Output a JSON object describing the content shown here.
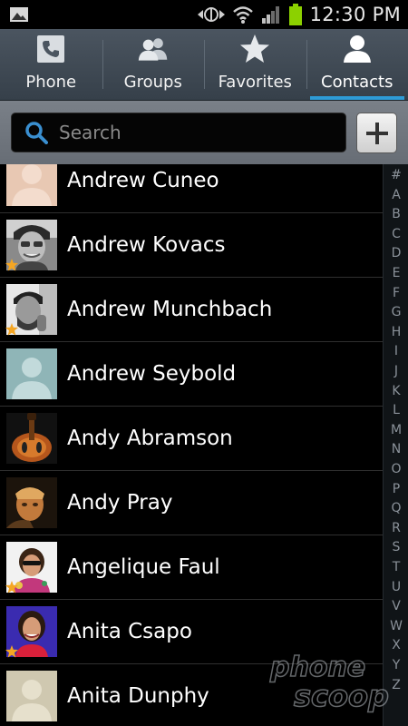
{
  "status_bar": {
    "time": "12:30 PM",
    "icons": [
      "gallery-notification-icon",
      "data-sync-icon",
      "wifi-icon",
      "signal-icon",
      "battery-icon"
    ],
    "battery_color": "#8cd100"
  },
  "tabs": [
    {
      "label": "Phone",
      "icon": "phone-icon",
      "active": false
    },
    {
      "label": "Groups",
      "icon": "groups-icon",
      "active": false
    },
    {
      "label": "Favorites",
      "icon": "star-icon",
      "active": false
    },
    {
      "label": "Contacts",
      "icon": "contact-person-icon",
      "active": true
    }
  ],
  "search": {
    "placeholder": "Search",
    "value": ""
  },
  "add_button": {
    "icon": "plus-icon"
  },
  "contacts": [
    {
      "name": "Andrew Cuneo",
      "favorite": false,
      "avatar": "default-avatar-tan"
    },
    {
      "name": "Andrew Kovacs",
      "favorite": true,
      "avatar": "photo-bw-face"
    },
    {
      "name": "Andrew Munchbach",
      "favorite": true,
      "avatar": "photo-bw-beard"
    },
    {
      "name": "Andrew Seybold",
      "favorite": false,
      "avatar": "default-avatar-teal"
    },
    {
      "name": "Andy Abramson",
      "favorite": false,
      "avatar": "photo-guitar"
    },
    {
      "name": "Andy Pray",
      "favorite": false,
      "avatar": "photo-warm-face"
    },
    {
      "name": "Angelique Faul",
      "favorite": true,
      "avatar": "photo-woman-sunglasses"
    },
    {
      "name": "Anita Csapo",
      "favorite": true,
      "avatar": "photo-woman-red"
    },
    {
      "name": "Anita Dunphy",
      "favorite": false,
      "avatar": "default-avatar-tan"
    }
  ],
  "index_letters": [
    "#",
    "A",
    "B",
    "C",
    "D",
    "E",
    "F",
    "G",
    "H",
    "I",
    "J",
    "K",
    "L",
    "M",
    "N",
    "O",
    "P",
    "Q",
    "R",
    "S",
    "T",
    "U",
    "V",
    "W",
    "X",
    "Y",
    "Z"
  ],
  "colors": {
    "active_tab_indicator": "#2e9bd6",
    "favorite_star": "#f5a623",
    "search_icon": "#3a8fd0"
  }
}
